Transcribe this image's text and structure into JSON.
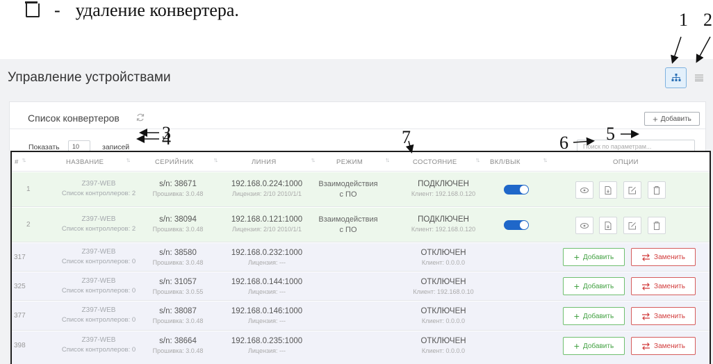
{
  "doc": {
    "delete_text": "удаление конвертера.",
    "dash": "-"
  },
  "callouts": [
    "1",
    "2",
    "3",
    "4",
    "5",
    "6",
    "7"
  ],
  "page_title": "Управление устройствами",
  "converter_list_title": "Список конвертеров",
  "add_button_top": "Добавить",
  "show_label": "Показать",
  "entries_value": "10",
  "entries_label": "записей",
  "search_placeholder": "Поиск по параметрам...",
  "columns": {
    "num": "#",
    "name": "НАЗВАНИЕ",
    "serial": "СЕРИЙНИК",
    "line": "ЛИНИЯ",
    "mode": "РЕЖИМ",
    "state": "СОСТОЯНИЕ",
    "onoff": "ВКЛ/ВЫК",
    "options": "ОПЦИИ"
  },
  "rows": [
    {
      "num": "1",
      "name": "Z397-WEB",
      "controllers": "Список контроллеров: 2",
      "serial": "s/n: 38671",
      "firmware": "Прошивка: 3.0.48",
      "line": "192.168.0.224:1000",
      "license": "Лицензия: 2/10 2010/1/1",
      "mode_1": "Взаимодействия",
      "mode_2": "с ПО",
      "state": "ПОДКЛЮЧЕН",
      "client": "Клиент: 192.168.0.120",
      "enabled": true
    },
    {
      "num": "2",
      "name": "Z397-WEB",
      "controllers": "Список контроллеров: 2",
      "serial": "s/n: 38094",
      "firmware": "Прошивка: 3.0.48",
      "line": "192.168.0.121:1000",
      "license": "Лицензия: 2/10 2010/1/1",
      "mode_1": "Взаимодействия",
      "mode_2": "с ПО",
      "state": "ПОДКЛЮЧЕН",
      "client": "Клиент: 192.168.0.120",
      "enabled": true
    },
    {
      "num": "317",
      "name": "Z397-WEB",
      "controllers": "Список контроллеров: 0",
      "serial": "s/n: 38580",
      "firmware": "Прошивка: 3.0.48",
      "line": "192.168.0.232:1000",
      "license": "Лицензия: ---",
      "state": "ОТКЛЮЧЕН",
      "client": "Клиент: 0.0.0.0"
    },
    {
      "num": "325",
      "name": "Z397-WEB",
      "controllers": "Список контроллеров: 0",
      "serial": "s/n: 31057",
      "firmware": "Прошивка: 3.0.55",
      "line": "192.168.0.144:1000",
      "license": "Лицензия: ---",
      "state": "ОТКЛЮЧЕН",
      "client": "Клиент: 192.168.0.10"
    },
    {
      "num": "377",
      "name": "Z397-WEB",
      "controllers": "Список контроллеров: 0",
      "serial": "s/n: 38087",
      "firmware": "Прошивка: 3.0.48",
      "line": "192.168.0.146:1000",
      "license": "Лицензия: ---",
      "state": "ОТКЛЮЧЕН",
      "client": "Клиент: 0.0.0.0"
    },
    {
      "num": "398",
      "name": "Z397-WEB",
      "controllers": "Список контроллеров: 0",
      "serial": "s/n: 38664",
      "firmware": "Прошивка: 3.0.48",
      "line": "192.168.0.235:1000",
      "license": "Лицензия: ---",
      "state": "ОТКЛЮЧЕН",
      "client": "Клиент: 0.0.0.0"
    }
  ],
  "row_add_label": "Добавить",
  "row_replace_label": "Заменить",
  "colors": {
    "panel_bg": "#f1f2f4",
    "connected_row": "#edf7ec",
    "disconnected_row": "#f1f2f9",
    "toggle_on": "#1f67c9",
    "add_green": "#44a244",
    "replace_red": "#d23c3c",
    "view_active": "#2a6fb5"
  }
}
